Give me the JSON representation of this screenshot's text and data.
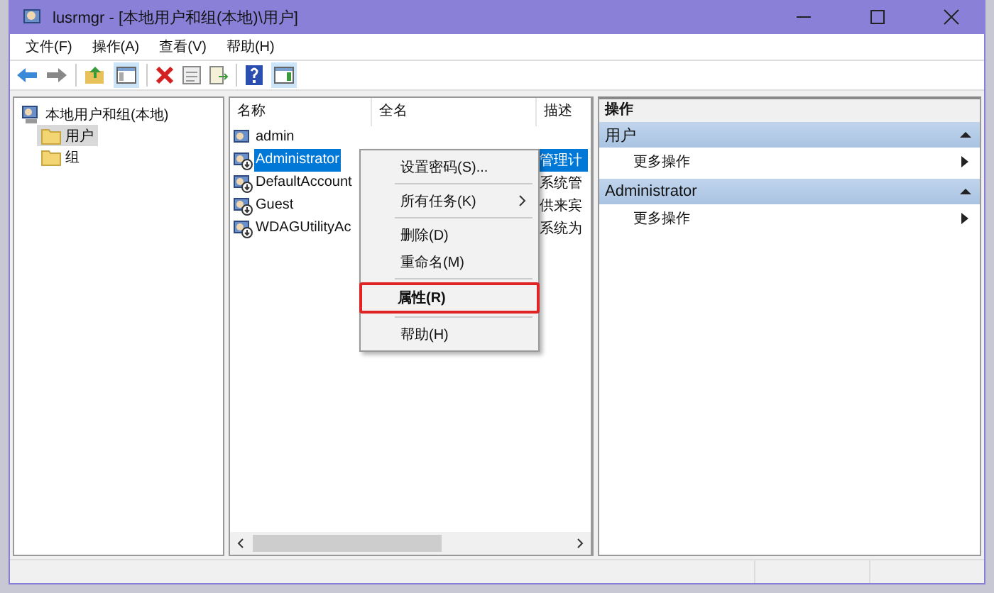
{
  "window": {
    "title": "lusrmgr - [本地用户和组(本地)\\用户]"
  },
  "menu": [
    "文件(F)",
    "操作(A)",
    "查看(V)",
    "帮助(H)"
  ],
  "tree": [
    {
      "label": "本地用户和组(本地)",
      "kind": "computer",
      "selected": false,
      "children": [
        {
          "label": "用户",
          "kind": "folder",
          "selected": true
        },
        {
          "label": "组",
          "kind": "folder",
          "selected": false
        }
      ]
    }
  ],
  "table": {
    "columns": [
      "名称",
      "全名",
      "描述"
    ],
    "rows": [
      {
        "name": "admin",
        "full_name": "",
        "description": "",
        "disabled": false,
        "selected": false
      },
      {
        "name": "Administrator",
        "full_name": "",
        "description": "管理计",
        "disabled": true,
        "selected": true
      },
      {
        "name": "DefaultAccount",
        "full_name": "",
        "description": "系统管",
        "disabled": true,
        "selected": false
      },
      {
        "name": "Guest",
        "full_name": "",
        "description": "供来宾",
        "disabled": true,
        "selected": false
      },
      {
        "name": "WDAGUtilityAc",
        "full_name": "",
        "description": "系统为",
        "disabled": true,
        "selected": false
      }
    ]
  },
  "context_menu": [
    {
      "kind": "item",
      "label": "设置密码(S)...",
      "submenu": false,
      "highlighted": false
    },
    {
      "kind": "separator"
    },
    {
      "kind": "item",
      "label": "所有任务(K)",
      "submenu": true,
      "highlighted": false
    },
    {
      "kind": "separator"
    },
    {
      "kind": "item",
      "label": "删除(D)",
      "submenu": false,
      "highlighted": false
    },
    {
      "kind": "item",
      "label": "重命名(M)",
      "submenu": false,
      "highlighted": false
    },
    {
      "kind": "separator"
    },
    {
      "kind": "item",
      "label": "属性(R)",
      "submenu": false,
      "highlighted": true
    },
    {
      "kind": "separator"
    },
    {
      "kind": "item",
      "label": "帮助(H)",
      "submenu": false,
      "highlighted": false
    }
  ],
  "actions": {
    "title": "操作",
    "sections": [
      {
        "title": "用户",
        "items": [
          "更多操作"
        ]
      },
      {
        "title": "Administrator",
        "items": [
          "更多操作"
        ]
      }
    ]
  }
}
